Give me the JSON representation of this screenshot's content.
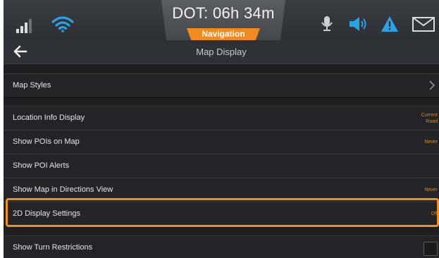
{
  "status_bar": {
    "dot_time": "DOT: 06h 34m",
    "mode_tab": "Navigation",
    "icons": [
      "signal-bars-icon",
      "wifi-icon",
      "microphone-icon",
      "speaker-icon",
      "warning-icon",
      "mail-icon"
    ]
  },
  "header": {
    "title": "Map Display",
    "back_icon": "back-arrow-icon"
  },
  "settings": {
    "map_styles": {
      "label": "Map Styles"
    },
    "location_info": {
      "label": "Location Info Display",
      "value_line1": "Current",
      "value_line2": "Road"
    },
    "show_pois": {
      "label": "Show POIs on Map",
      "value": "Never"
    },
    "poi_alerts": {
      "label": "Show POI Alerts"
    },
    "map_in_directions": {
      "label": "Show Map in Directions View",
      "value": "Never"
    },
    "display_2d": {
      "label": "2D Display Settings",
      "value": "Off"
    },
    "turn_restrictions": {
      "label": "Show Turn Restrictions",
      "checked": false
    }
  },
  "colors": {
    "accent_orange": "#f39019",
    "wifi_blue": "#2aa3e6",
    "background": "#1f1f21"
  }
}
